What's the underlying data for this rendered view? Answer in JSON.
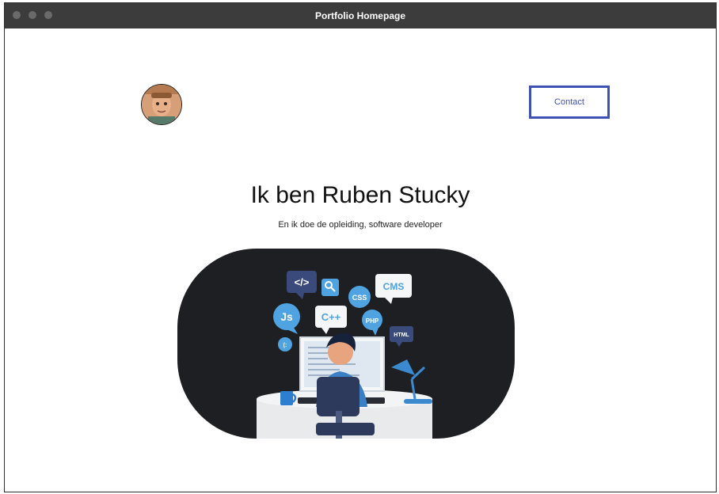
{
  "window": {
    "title": "Portfolio Homepage"
  },
  "header": {
    "contact_label": "Contact"
  },
  "hero": {
    "title": "Ik ben Ruben Stucky",
    "subtitle": "En ik doe de opleiding, software developer"
  },
  "illustration": {
    "code_icon": "</>",
    "css_icon": "CSS",
    "cms_icon": "CMS",
    "js_icon": "Js",
    "cpp_icon": "C++",
    "php_icon": "PHP",
    "html_icon": "HTML",
    "emoticon": "(:"
  },
  "colors": {
    "accent": "#3f51b5",
    "titlebar": "#3c3c3c",
    "illustration_bg": "#1e1f23"
  }
}
